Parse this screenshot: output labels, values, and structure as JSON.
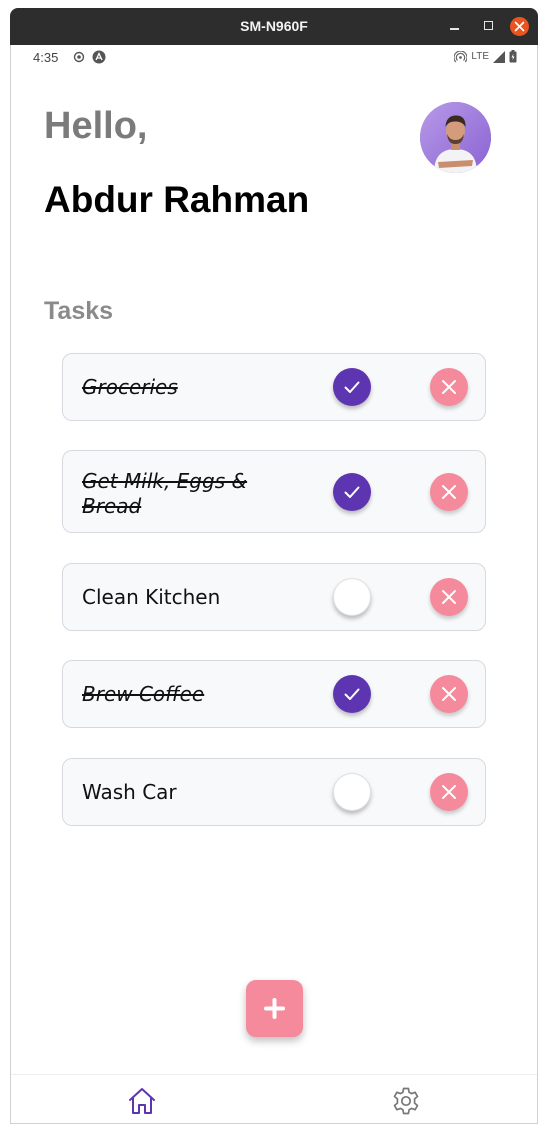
{
  "window": {
    "title": "SM-N960F"
  },
  "statusbar": {
    "time": "4:35",
    "network": "LTE"
  },
  "header": {
    "greeting": "Hello,",
    "name": "Abdur Rahman"
  },
  "tasks": {
    "title": "Tasks",
    "items": [
      {
        "label": "Groceries",
        "done": true
      },
      {
        "label": "Get Milk, Eggs & Bread",
        "done": true
      },
      {
        "label": "Clean Kitchen",
        "done": false
      },
      {
        "label": "Brew Coffee",
        "done": true
      },
      {
        "label": "Wash Car",
        "done": false
      }
    ]
  },
  "colors": {
    "accent": "#5e35b1",
    "pink": "#f48a9b",
    "nav_active": "#5e35b1",
    "nav_inactive": "#777777"
  },
  "icons": {
    "add": "plus-icon",
    "home": "home-icon",
    "settings": "gear-icon",
    "check": "check-icon",
    "delete": "close-icon"
  }
}
